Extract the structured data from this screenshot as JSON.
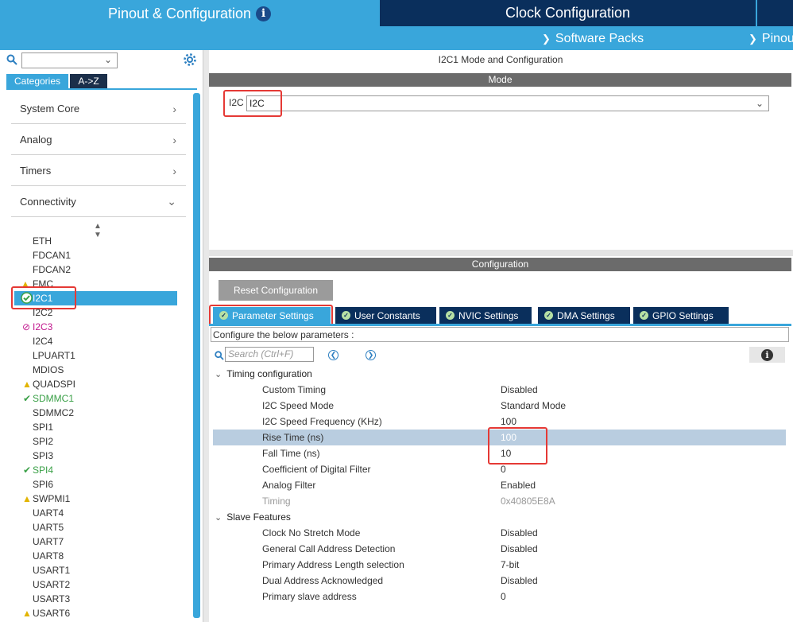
{
  "header": {
    "tabs": {
      "pinout": "Pinout & Configuration",
      "clock": "Clock Configuration"
    },
    "submenu": {
      "software_packs": "Software Packs",
      "pinout": "Pinou"
    }
  },
  "sidebar": {
    "search": {
      "value": ""
    },
    "tabs": {
      "categories": "Categories",
      "az": "A->Z"
    },
    "categories": [
      {
        "label": "System Core",
        "expanded": false
      },
      {
        "label": "Analog",
        "expanded": false
      },
      {
        "label": "Timers",
        "expanded": false
      },
      {
        "label": "Connectivity",
        "expanded": true
      }
    ],
    "peripherals": [
      {
        "label": "ETH",
        "status": "none"
      },
      {
        "label": "FDCAN1",
        "status": "none"
      },
      {
        "label": "FDCAN2",
        "status": "none"
      },
      {
        "label": "FMC",
        "status": "warning"
      },
      {
        "label": "I2C1",
        "status": "selected"
      },
      {
        "label": "I2C2",
        "status": "none"
      },
      {
        "label": "I2C3",
        "status": "disabled"
      },
      {
        "label": "I2C4",
        "status": "none"
      },
      {
        "label": "LPUART1",
        "status": "none"
      },
      {
        "label": "MDIOS",
        "status": "none"
      },
      {
        "label": "QUADSPI",
        "status": "warning"
      },
      {
        "label": "SDMMC1",
        "status": "ok"
      },
      {
        "label": "SDMMC2",
        "status": "none"
      },
      {
        "label": "SPI1",
        "status": "none"
      },
      {
        "label": "SPI2",
        "status": "none"
      },
      {
        "label": "SPI3",
        "status": "none"
      },
      {
        "label": "SPI4",
        "status": "ok"
      },
      {
        "label": "SPI6",
        "status": "none"
      },
      {
        "label": "SWPMI1",
        "status": "warning"
      },
      {
        "label": "UART4",
        "status": "none"
      },
      {
        "label": "UART5",
        "status": "none"
      },
      {
        "label": "UART7",
        "status": "none"
      },
      {
        "label": "UART8",
        "status": "none"
      },
      {
        "label": "USART1",
        "status": "none"
      },
      {
        "label": "USART2",
        "status": "none"
      },
      {
        "label": "USART3",
        "status": "none"
      },
      {
        "label": "USART6",
        "status": "warning"
      }
    ]
  },
  "main": {
    "title": "I2C1 Mode and Configuration",
    "mode_section": "Mode",
    "mode_label": "I2C",
    "mode_value": "I2C",
    "config_section": "Configuration",
    "reset_button": "Reset Configuration",
    "tabs": [
      "Parameter Settings",
      "User Constants",
      "NVIC Settings",
      "DMA Settings",
      "GPIO Settings"
    ],
    "configure_hint": "Configure the below parameters :",
    "search_placeholder": "Search (Ctrl+F)",
    "groups": [
      {
        "name": "Timing configuration",
        "params": [
          {
            "name": "Custom Timing",
            "value": "Disabled"
          },
          {
            "name": "I2C Speed Mode",
            "value": "Standard Mode"
          },
          {
            "name": "I2C Speed Frequency (KHz)",
            "value": "100"
          },
          {
            "name": "Rise Time (ns)",
            "value": "100"
          },
          {
            "name": "Fall Time (ns)",
            "value": "10"
          },
          {
            "name": "Coefficient of Digital Filter",
            "value": "0"
          },
          {
            "name": "Analog Filter",
            "value": "Enabled"
          },
          {
            "name": "Timing",
            "value": "0x40805E8A"
          }
        ]
      },
      {
        "name": "Slave Features",
        "params": [
          {
            "name": "Clock No Stretch Mode",
            "value": "Disabled"
          },
          {
            "name": "General Call Address Detection",
            "value": "Disabled"
          },
          {
            "name": "Primary Address Length selection",
            "value": "7-bit"
          },
          {
            "name": "Dual Address Acknowledged",
            "value": "Disabled"
          },
          {
            "name": "Primary slave address",
            "value": "0"
          }
        ]
      }
    ]
  },
  "colors": {
    "accent": "#39a6db",
    "dark_navy": "#0a2f5c",
    "highlight_row": "#b9cde0",
    "annotation_red": "#e53935",
    "ok_green": "#3aa047",
    "warning_yellow": "#e2b400",
    "disabled_magenta": "#c2188e"
  }
}
